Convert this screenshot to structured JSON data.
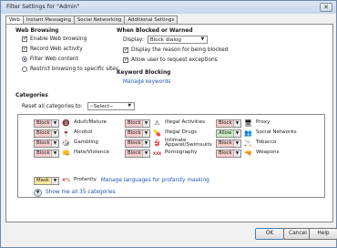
{
  "window": {
    "title": "Filter Settings for \"Admin\"",
    "close_glyph": "✕"
  },
  "tabs": [
    "Web",
    "Instant Messaging",
    "Social Networking",
    "Additional Settings"
  ],
  "web_browsing": {
    "heading": "Web Browsing",
    "options": [
      {
        "label": "Enable Web browsing",
        "type": "checkbox",
        "checked": true
      },
      {
        "label": "Record Web activity",
        "type": "checkbox",
        "checked": true
      },
      {
        "label": "Filter Web content",
        "type": "radio",
        "checked": true
      },
      {
        "label": "Restrict browsing to specific sites",
        "type": "radio",
        "checked": false
      }
    ]
  },
  "blocked": {
    "heading": "When Blocked or Warned",
    "display_label": "Display:",
    "display_value": "Block dialog",
    "options": [
      {
        "label": "Display the reason for being blocked",
        "checked": true
      },
      {
        "label": "Allow user to request exceptions",
        "checked": true
      }
    ]
  },
  "keyword": {
    "heading": "Keyword Blocking",
    "link": "Manage keywords"
  },
  "categories": {
    "heading": "Categories",
    "reset_label": "Reset all categories to:",
    "reset_value": "--Select--",
    "items": [
      {
        "name": "Adult/Mature",
        "setting": "Block",
        "icon": "adult-icon",
        "glyph": "🔞"
      },
      {
        "name": "Illegal Activities",
        "setting": "Block",
        "icon": "illegal-icon",
        "glyph": "⚠"
      },
      {
        "name": "Proxy",
        "setting": "Block",
        "icon": "proxy-icon",
        "glyph": "🖥"
      },
      {
        "name": "Alcohol",
        "setting": "Block",
        "icon": "alcohol-icon",
        "glyph": "🍷"
      },
      {
        "name": "Illegal Drugs",
        "setting": "Block",
        "icon": "drugs-icon",
        "glyph": "💊"
      },
      {
        "name": "Social Networks",
        "setting": "Allow",
        "icon": "social-icon",
        "glyph": "👥"
      },
      {
        "name": "Gambling",
        "setting": "Block",
        "icon": "gambling-icon",
        "glyph": "🎲"
      },
      {
        "name": "Intimate Apparel/Swimsuits",
        "setting": "Block",
        "icon": "apparel-icon",
        "glyph": "👙"
      },
      {
        "name": "Tobacco",
        "setting": "Block",
        "icon": "tobacco-icon",
        "glyph": "🚬"
      },
      {
        "name": "Hate/Violence",
        "setting": "Block",
        "icon": "hate-icon",
        "glyph": "👊"
      },
      {
        "name": "Pornography",
        "setting": "Block",
        "icon": "pornography-icon",
        "glyph": "XXX"
      },
      {
        "name": "Weapons",
        "setting": "Block",
        "icon": "weapons-icon",
        "glyph": "🔫"
      }
    ],
    "profanity": {
      "setting": "Mask",
      "name": "Profanity",
      "link": "Manage languages for profanity masking",
      "glyph": "#%"
    },
    "show_all": "Show me all 35 categories"
  },
  "buttons": {
    "ok": "OK",
    "cancel": "Cancel",
    "help": "Help"
  },
  "colors": {
    "block": "#f7cccc",
    "allow": "#c8efc0",
    "mask": "#fbe8a0",
    "link": "#1b55b0"
  }
}
